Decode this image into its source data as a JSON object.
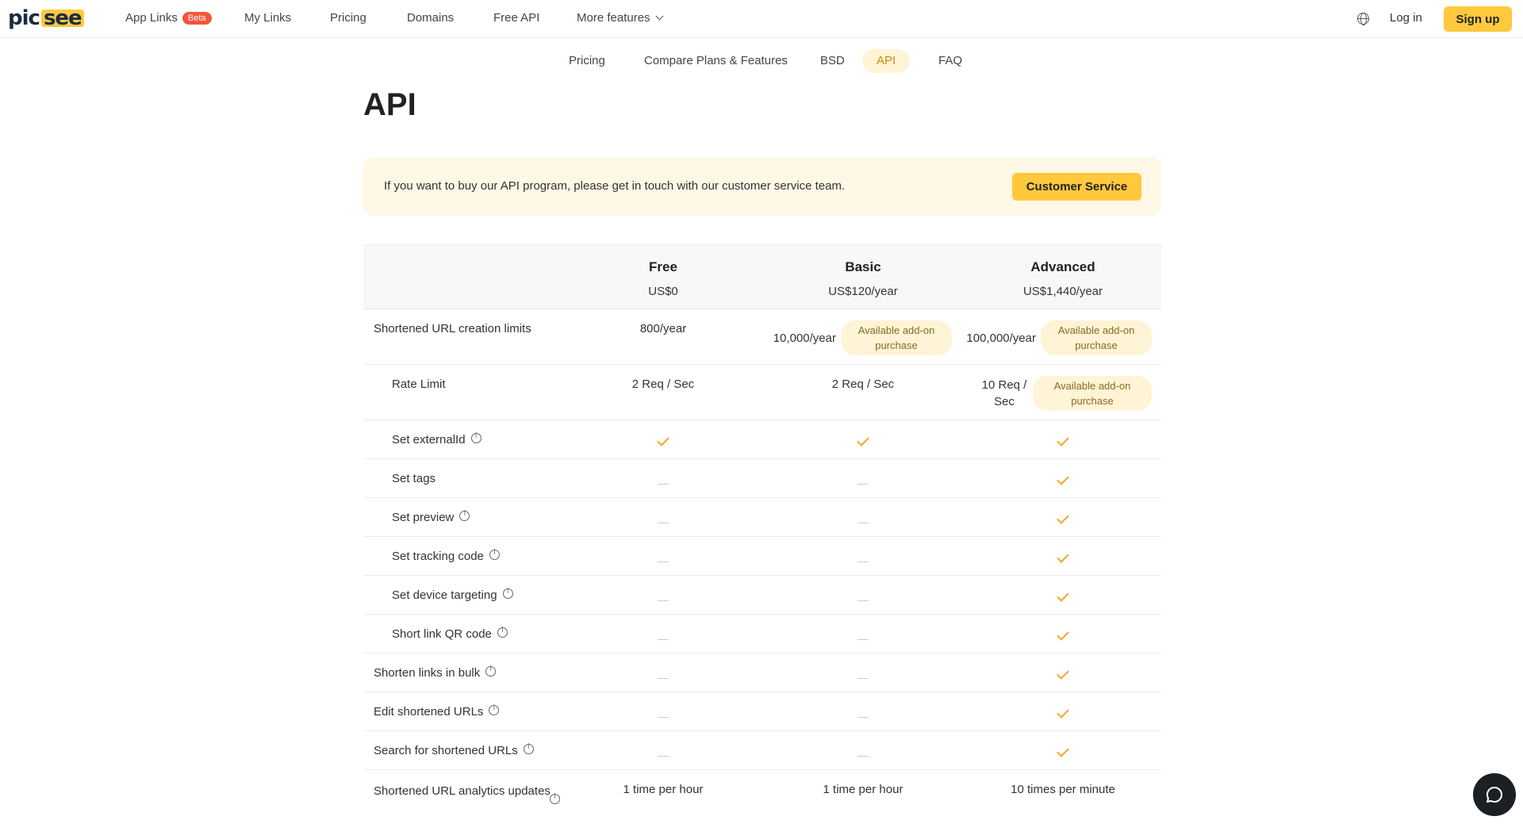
{
  "nav": {
    "logo_a": "pic",
    "logo_b": "see",
    "app_links": "App Links",
    "beta": "Beta",
    "my_links": "My Links",
    "pricing": "Pricing",
    "domains": "Domains",
    "free_api": "Free API",
    "more_features": "More features",
    "login": "Log in",
    "signup": "Sign up"
  },
  "subtabs": {
    "pricing": "Pricing",
    "compare": "Compare Plans & Features",
    "bsd": "BSD",
    "api": "API",
    "faq": "FAQ"
  },
  "page_title": "API",
  "banner": {
    "text": "If you want to buy our API program, please get in touch with our customer service team.",
    "button": "Customer Service"
  },
  "plans": [
    {
      "name": "Free",
      "price": "US$0"
    },
    {
      "name": "Basic",
      "price": "US$120/year"
    },
    {
      "name": "Advanced",
      "price": "US$1,440/year"
    }
  ],
  "rows": {
    "url_limits": {
      "label": "Shortened URL creation limits",
      "free": "800/year",
      "basic": "10,000/year",
      "advanced": "100,000/year",
      "addon": "Available add-on purchase"
    },
    "rate_limit": {
      "label": "Rate Limit",
      "free": "2 Req / Sec",
      "basic": "2 Req / Sec",
      "advanced": "10 Req / Sec",
      "addon": "Available add-on purchase"
    },
    "external_id": {
      "label": "Set externalId"
    },
    "tags": {
      "label": "Set tags"
    },
    "preview": {
      "label": "Set preview"
    },
    "tracking": {
      "label": "Set tracking code"
    },
    "device": {
      "label": "Set device targeting"
    },
    "qr": {
      "label": "Short link QR code"
    },
    "bulk": {
      "label": "Shorten links in bulk"
    },
    "edit": {
      "label": "Edit shortened URLs"
    },
    "search": {
      "label": "Search for shortened URLs"
    },
    "analytics": {
      "label": "Shortened URL analytics updates",
      "free": "1 time per hour",
      "basic": "1 time per hour",
      "advanced": "10 times per minute"
    }
  },
  "colors": {
    "accent": "#ffc83d",
    "check": "#f5a623",
    "badge": "#f5543a"
  }
}
